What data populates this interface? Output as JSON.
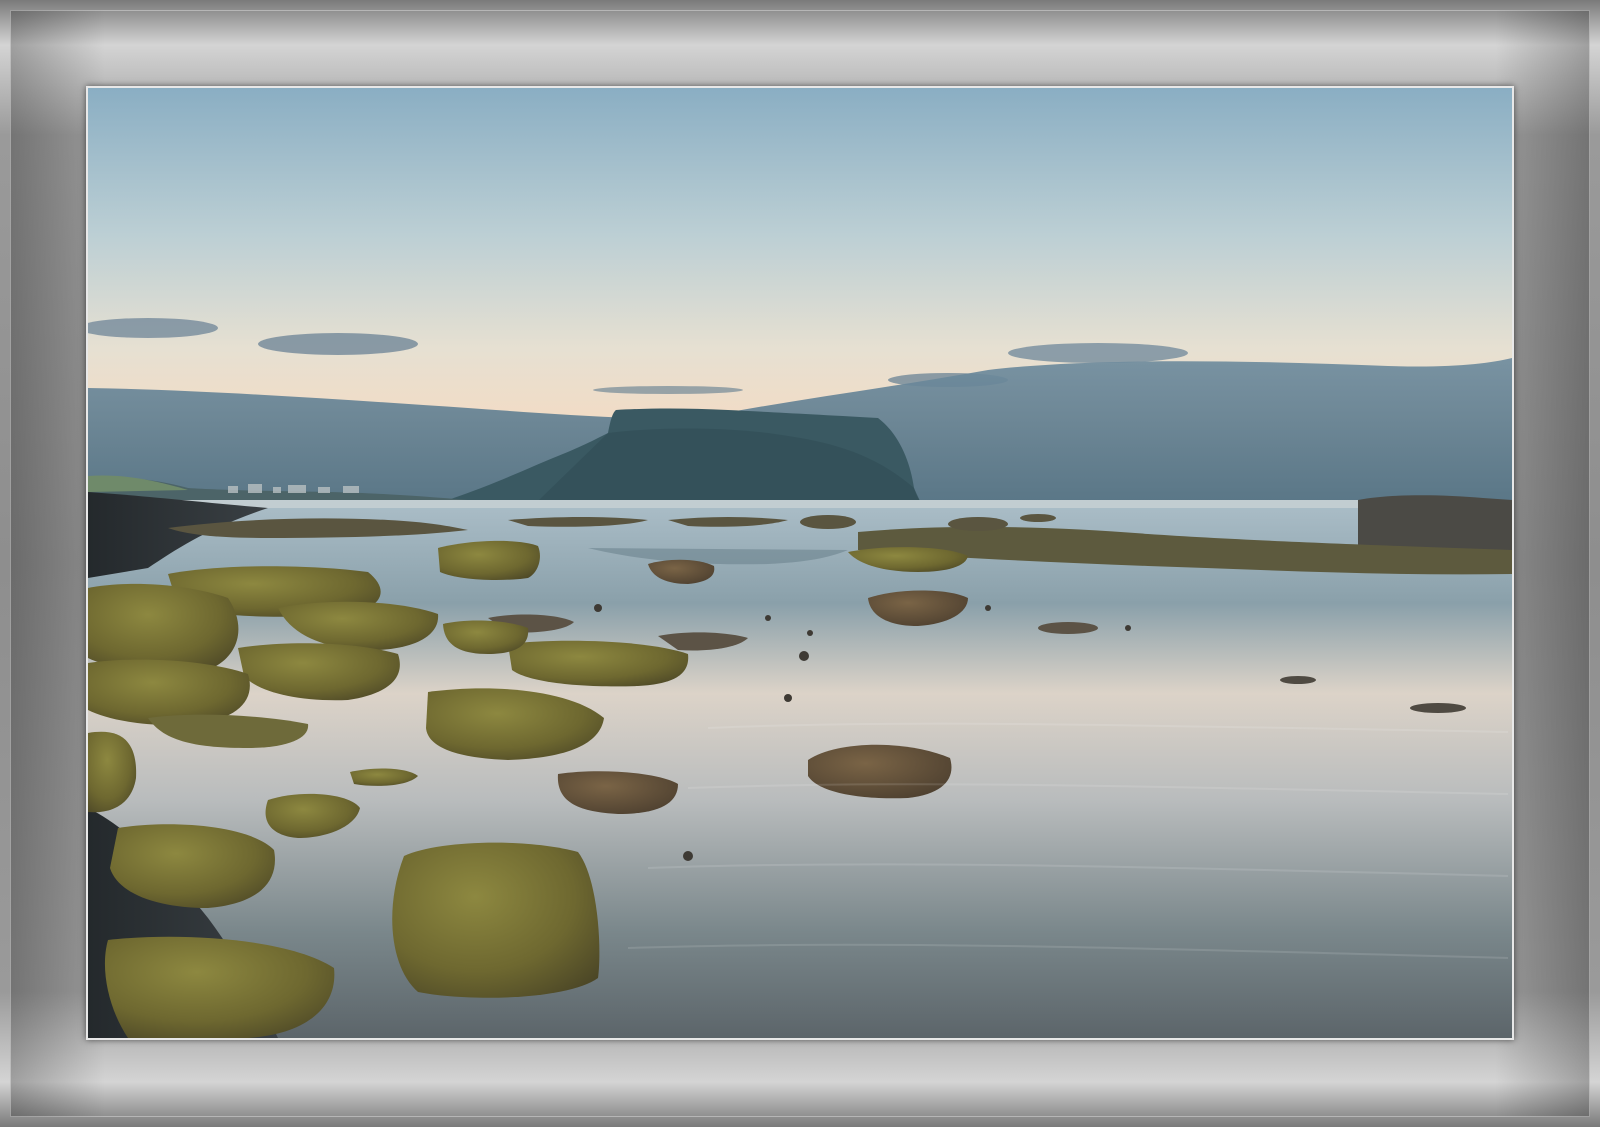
{
  "scene": {
    "subject": "coastal-tidepool-landscape",
    "colors": {
      "sky_top": "#8fb0c4",
      "sky_mid": "#cfd8d8",
      "sky_glow": "#f0dcc8",
      "cloud_band": "#5f7f93",
      "headland": "#3b5a63",
      "water_reflect": "#d9d3cc",
      "water_deep": "#5d6f77",
      "moss_rock": "#7a7432",
      "dark_sand": "#2e3438",
      "frame": "#9a9a9a"
    }
  }
}
